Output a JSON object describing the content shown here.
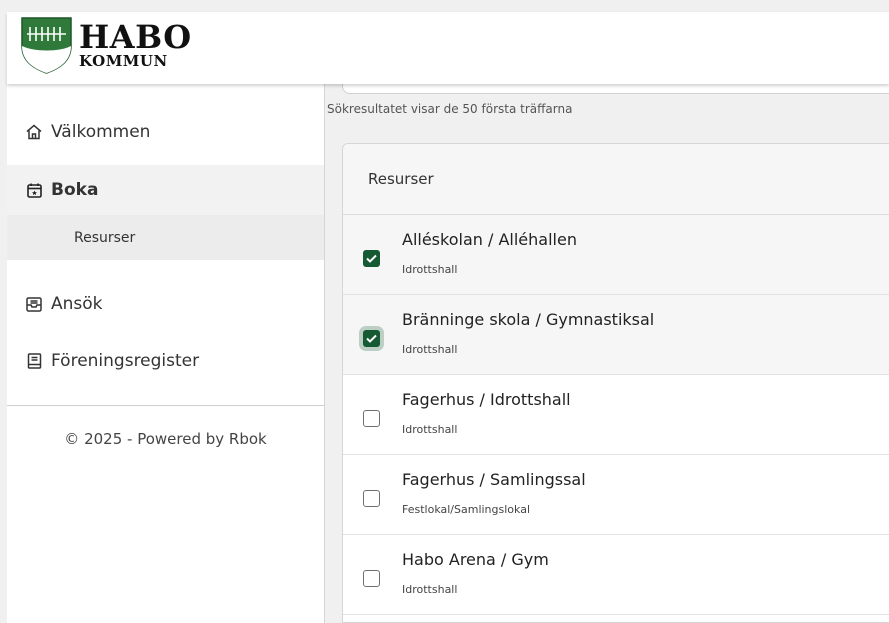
{
  "header": {
    "logo_line1": "HABO",
    "logo_line2": "KOMMUN"
  },
  "sidebar": {
    "items": [
      {
        "label": "Välkommen",
        "icon": "home-icon"
      },
      {
        "label": "Boka",
        "icon": "calendar-icon"
      },
      {
        "label": "Resurser",
        "icon": ""
      },
      {
        "label": "Ansök",
        "icon": "inbox-icon"
      },
      {
        "label": "Föreningsregister",
        "icon": "book-icon"
      }
    ],
    "footer": "© 2025 - Powered by Rbok"
  },
  "main": {
    "search_info": "Sökresultatet visar de 50 första träffarna",
    "list_header": "Resurser",
    "resources": [
      {
        "title": "Alléskolan / Alléhallen",
        "type": "Idrottshall",
        "checked": true
      },
      {
        "title": "Bränninge skola / Gymnastiksal",
        "type": "Idrottshall",
        "checked": true
      },
      {
        "title": "Fagerhus / Idrottshall",
        "type": "Idrottshall",
        "checked": false
      },
      {
        "title": "Fagerhus / Samlingssal",
        "type": "Festlokal/Samlingslokal",
        "checked": false
      },
      {
        "title": "Habo Arena / Gym",
        "type": "Idrottshall",
        "checked": false
      }
    ]
  },
  "colors": {
    "brand_green": "#155a33",
    "selected_bg": "#f6f6f6"
  }
}
